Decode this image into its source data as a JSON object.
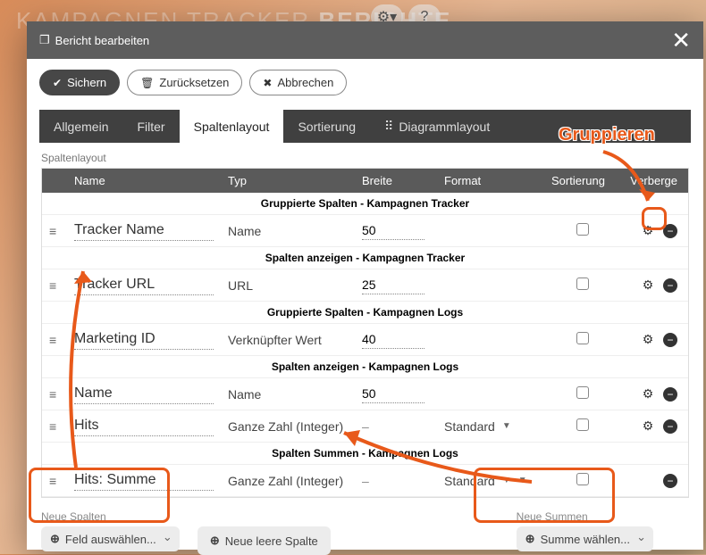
{
  "bg": {
    "line1a": "KAMPAGNEN TRACKER",
    "line1b": "BERICHTE"
  },
  "modal": {
    "title": "Bericht bearbeiten"
  },
  "toolbar": {
    "save": "Sichern",
    "reset": "Zurücksetzen",
    "cancel": "Abbrechen"
  },
  "tabs": {
    "general": "Allgemein",
    "filter": "Filter",
    "layout": "Spaltenlayout",
    "sort": "Sortierung",
    "chart": "Diagrammlayout"
  },
  "section": "Spaltenlayout",
  "headers": {
    "name": "Name",
    "typ": "Typ",
    "breite": "Breite",
    "format": "Format",
    "sort": "Sortierung",
    "verb": "Verberge"
  },
  "groups": {
    "g1": "Gruppierte Spalten - Kampagnen Tracker",
    "g2": "Spalten anzeigen - Kampagnen Tracker",
    "g3": "Gruppierte Spalten - Kampagnen Logs",
    "g4": "Spalten anzeigen - Kampagnen Logs",
    "g5": "Spalten Summen - Kampagnen Logs"
  },
  "rows": {
    "r1": {
      "name": "Tracker Name",
      "typ": "Name",
      "breite": "50",
      "format": "",
      "hasGear": true
    },
    "r2": {
      "name": "Tracker URL",
      "typ": "URL",
      "breite": "25",
      "format": "",
      "hasGear": true
    },
    "r3": {
      "name": "Marketing ID",
      "typ": "Verknüpfter Wert",
      "breite": "40",
      "format": "",
      "hasGear": true
    },
    "r4": {
      "name": "Name",
      "typ": "Name",
      "breite": "50",
      "format": "",
      "hasGear": true
    },
    "r5": {
      "name": "Hits",
      "typ": "Ganze Zahl (Integer)",
      "breite": "–",
      "format": "Standard",
      "hasGear": true
    },
    "r6": {
      "name": "Hits: Summe",
      "typ": "Ganze Zahl (Integer)",
      "breite": "–",
      "format": "Standard",
      "hasGear": false
    }
  },
  "bottom": {
    "newCols": "Neue Spalten",
    "fieldSelect": "Feld auswählen...",
    "newEmpty": "Neue leere Spalte",
    "newSums": "Neue Summen",
    "sumSelect": "Summe wählen..."
  },
  "callout": "Gruppieren"
}
